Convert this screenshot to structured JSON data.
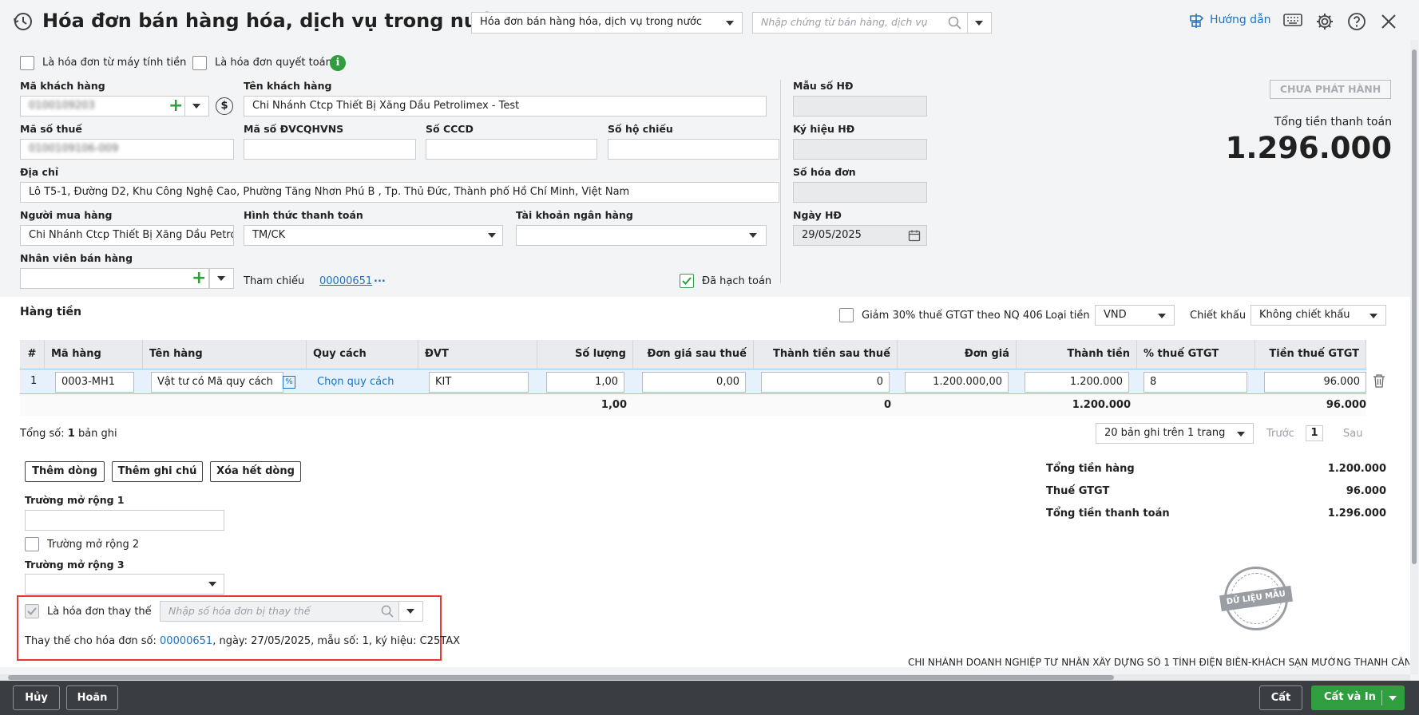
{
  "header": {
    "title": "Hóa đơn bán hàng hóa, dịch vụ trong nước",
    "doc_type_select": "Hóa đơn bán hàng hóa, dịch vụ trong nước",
    "search_placeholder": "Nhập chứng từ bán hàng, dịch vụ",
    "guide_label": "Hướng dẫn"
  },
  "options": {
    "cash_register": "Là hóa đơn từ máy tính tiền",
    "settlement": "Là hóa đơn quyết toán"
  },
  "form": {
    "customer_code_label": "Mã khách hàng",
    "customer_code_value": "0100109203",
    "customer_name_label": "Tên khách hàng",
    "customer_name_value": "Chi Nhánh Ctcp Thiết Bị Xăng Dầu Petrolimex - Test",
    "tax_code_label": "Mã số thuế",
    "tax_code_value": "0100109106-009",
    "budget_code_label": "Mã số ĐVCQHVNS",
    "cccd_label": "Số CCCD",
    "passport_label": "Số hộ chiếu",
    "address_label": "Địa chỉ",
    "address_value": "Lô T5-1, Đường D2, Khu Công Nghệ Cao, Phường Tăng Nhơn Phú B , Tp. Thủ Đức, Thành phố Hồ Chí Minh, Việt Nam",
    "buyer_label": "Người mua hàng",
    "buyer_value": "Chi Nhánh Ctcp Thiết Bị Xăng Dầu Petro",
    "payment_label": "Hình thức thanh toán",
    "payment_value": "TM/CK",
    "bank_label": "Tài khoản ngân hàng",
    "seller_label": "Nhân viên bán hàng",
    "reference_label": "Tham chiếu",
    "reference_value": "00000651",
    "reference_more": "...",
    "posted_label": "Đã hạch toán"
  },
  "invoice_info": {
    "template_label": "Mẫu số HĐ",
    "symbol_label": "Ký hiệu HĐ",
    "number_label": "Số hóa đơn",
    "date_label": "Ngày HĐ",
    "date_value": "29/05/2025",
    "status_badge": "CHƯA PHÁT HÀNH",
    "total_label": "Tổng tiền thanh toán",
    "total_value": "1.296.000"
  },
  "items_section": {
    "title": "Hàng tiền",
    "reduce_vat_label": "Giảm 30% thuế GTGT theo NQ 406",
    "currency_label": "Loại tiền",
    "currency_value": "VND",
    "discount_label": "Chiết khấu",
    "discount_value": "Không chiết khấu"
  },
  "table": {
    "columns": [
      "#",
      "Mã hàng",
      "Tên hàng",
      "Quy cách",
      "ĐVT",
      "Số lượng",
      "Đơn giá sau thuế",
      "Thành tiền sau thuế",
      "Đơn giá",
      "Thành tiền",
      "% thuế GTGT",
      "Tiền thuế GTGT"
    ],
    "row": {
      "no": "1",
      "code": "0003-MH1",
      "name": "Vật tư có Mã quy cách",
      "spec": "Chọn quy cách",
      "unit": "KIT",
      "qty": "1,00",
      "price_after_tax": "0,00",
      "amount_after_tax": "0",
      "price": "1.200.000,00",
      "amount": "1.200.000",
      "vat_rate": "8",
      "vat_amount": "96.000"
    },
    "totals": {
      "qty": "1,00",
      "amount_after_tax": "0",
      "amount": "1.200.000",
      "vat_amount": "96.000"
    }
  },
  "pager": {
    "total_prefix": "Tổng số:",
    "total_count": "1",
    "total_suffix": "bản ghi",
    "page_size": "20 bản ghi trên 1 trang",
    "prev": "Trước",
    "page": "1",
    "next": "Sau"
  },
  "actions": {
    "add_row": "Thêm dòng",
    "add_note": "Thêm ghi chú",
    "delete_rows": "Xóa hết dòng"
  },
  "extended": {
    "field1_label": "Trường mở rộng 1",
    "field2_label": "Trường mở rộng 2",
    "field3_label": "Trường mở rộng 3"
  },
  "replacement": {
    "label": "Là hóa đơn thay thế",
    "search_placeholder": "Nhập số hóa đơn bị thay thế",
    "info_prefix": "Thay thế cho hóa đơn số:",
    "invoice_no": "00000651",
    "info_rest": ", ngày:  27/05/2025, mẫu số:  1, ký hiệu:  C25TAX"
  },
  "summary": {
    "subtotal_label": "Tổng tiền hàng",
    "subtotal_value": "1.200.000",
    "vat_label": "Thuế GTGT",
    "vat_value": "96.000",
    "total_label": "Tổng tiền thanh toán",
    "total_value": "1.296.000"
  },
  "stamp": {
    "text": "DỮ LIỆU MẪU"
  },
  "company_name": "CHI NHÁNH DOANH NGHIỆP TƯ NHÂN XÂY DỰNG SỐ 1 TỈNH ĐIỆN BIÊN-KHÁCH SẠN MƯỜNG THANH CẦN THƠ",
  "footer": {
    "cancel": "Hủy",
    "undo": "Hoãn",
    "save": "Cất",
    "save_print": "Cất và In"
  },
  "colors": {
    "accent_green": "#2e9e3e",
    "link_blue": "#1a73c8",
    "highlight_red": "#e53935"
  }
}
